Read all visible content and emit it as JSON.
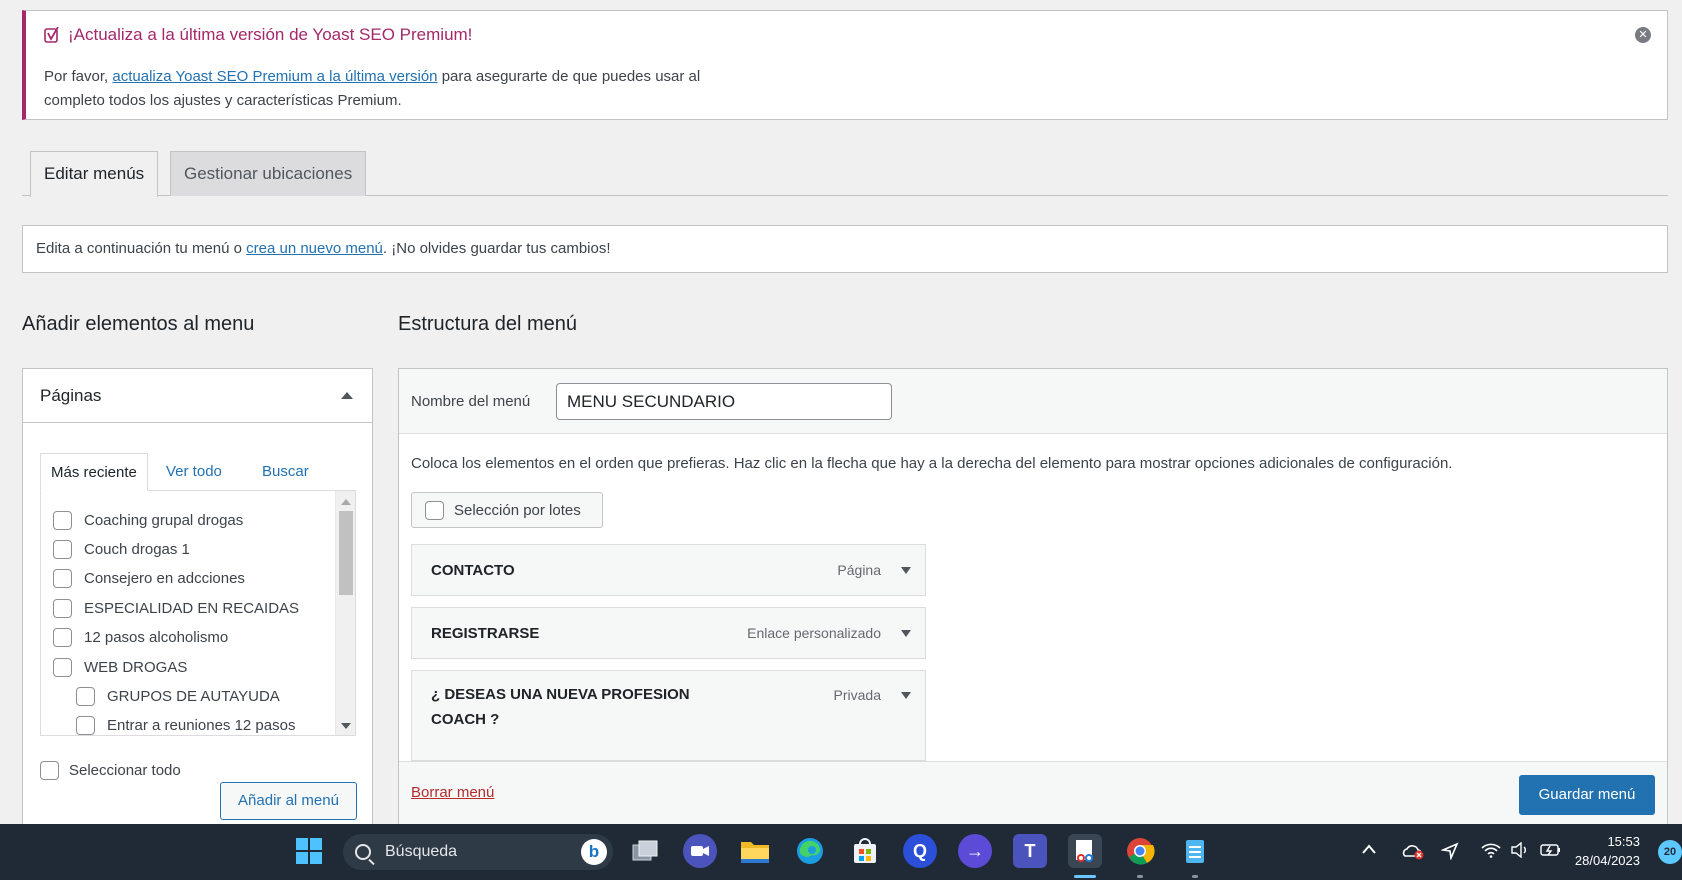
{
  "notice": {
    "title": "¡Actualiza a la última versión de Yoast SEO Premium!",
    "text_before": "Por favor, ",
    "link": "actualiza Yoast SEO Premium a la última versión",
    "text_after": " para asegurarte de que puedes usar al completo todos los ajustes y características Premium.",
    "close_icon": "close-icon",
    "accent_color": "#a4286a"
  },
  "tabs": {
    "edit": "Editar menús",
    "locations": "Gestionar ubicaciones"
  },
  "info": {
    "before": "Edita a continuación tu menú o ",
    "link": "crea un nuevo menú",
    "after": ". ¡No olvides guardar tus cambios!"
  },
  "left": {
    "title": "Añadir elementos al menu",
    "panel_title": "Páginas",
    "subtabs": [
      "Más reciente",
      "Ver todo",
      "Buscar"
    ],
    "pages": [
      "Coaching grupal drogas",
      "Couch drogas 1",
      "Consejero en adcciones",
      "ESPECIALIDAD EN RECAIDAS",
      "12 pasos alcoholismo",
      "WEB DROGAS",
      "GRUPOS DE AUTAYUDA",
      "Entrar a reuniones 12 pasos"
    ],
    "select_all": "Seleccionar todo",
    "add_button": "Añadir al menú"
  },
  "right": {
    "title": "Estructura del menú",
    "name_label": "Nombre del menú",
    "name_value": "MENU SECUNDARIO",
    "instructions": "Coloca los elementos en el orden que prefieras. Haz clic en la flecha que hay a la derecha del elemento para mostrar opciones adicionales de configuración.",
    "bulk_select": "Selección por lotes",
    "items": [
      {
        "title": "CONTACTO",
        "type": "Página"
      },
      {
        "title": "REGISTRARSE",
        "type": "Enlace personalizado"
      },
      {
        "title": "¿ DESEAS UNA NUEVA PROFESION COACH ?",
        "type": "Privada"
      }
    ],
    "delete_link": "Borrar menú",
    "save_button": "Guardar menú",
    "accent_color": "#2271b1"
  },
  "taskbar": {
    "search_placeholder": "Búsqueda",
    "apps": [
      "windows-start-icon",
      "bing-icon",
      "task-view-icon",
      "chat-icon",
      "file-explorer-icon",
      "edge-icon",
      "store-icon",
      "app-q-icon",
      "app-arrow-icon",
      "teams-icon",
      "snipping-tool-icon",
      "chrome-icon",
      "notepad-icon"
    ],
    "time": "15:53",
    "date": "28/04/2023",
    "notification_count": "20"
  }
}
